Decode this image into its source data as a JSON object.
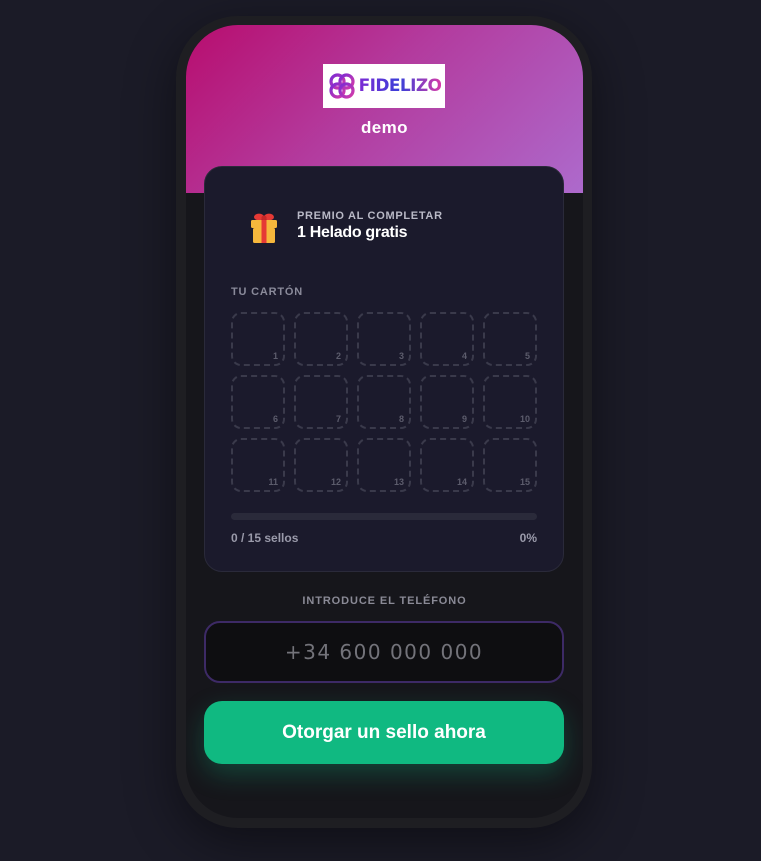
{
  "brand": {
    "logo_text": "FIDELIZO",
    "business_name": "demo"
  },
  "reward": {
    "kicker": "PREMIO AL COMPLETAR",
    "title": "1 Helado gratis",
    "icon": "gift-icon"
  },
  "stamp_card": {
    "label": "TU CARTÓN",
    "slots": [
      "1",
      "2",
      "3",
      "4",
      "5",
      "6",
      "7",
      "8",
      "9",
      "10",
      "11",
      "12",
      "13",
      "14",
      "15"
    ],
    "stamps_collected": 0,
    "progress_fraction": 0,
    "progress_count_text": "0 / 15 sellos",
    "progress_percent_text": "0%"
  },
  "phone_entry": {
    "label": "INTRODUCE EL TELÉFONO",
    "placeholder": "+34 600 000 000",
    "value": ""
  },
  "action": {
    "label": "Otorgar un sello ahora"
  },
  "colors": {
    "accent_green": "#10b981",
    "hero_gradient_start": "#b80d6e",
    "hero_gradient_end": "#ad6acc",
    "input_border": "#3d2a66"
  }
}
